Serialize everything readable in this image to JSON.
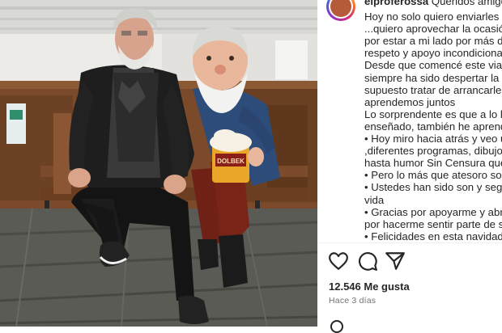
{
  "post": {
    "username": "elproferossa",
    "caption_first": "Queridos amigos",
    "caption_lines": [
      "Hoy no solo quiero enviarles un",
      "...quiero aprovechar la ocasión p",
      "por estar a mi lado por más de c",
      "respeto y apoyo incondicional",
      "Desde que comencé este viaje c",
      "siempre ha sido despertar la cur",
      "supuesto tratar de arrancarles u",
      "aprendemos juntos",
      "Lo sorprendente es que a lo larg",
      "enseñado, también he aprendid",
      "• Hoy miro hacia atrás y veo un",
      ",diferentes programas, dibujos ,c",
      "hasta humor Sin Censura que co",
      "• Pero lo más que atesoro son lo",
      "• Ustedes han sido son y seguirá",
      "vida",
      "• Gracias por apoyarme y abrirm",
      "por hacerme sentir parte de sus",
      "• Felicidades en esta navidad y c"
    ],
    "likes": "12.546 Me gusta",
    "time_ago": "Hace 3 días",
    "mug_label": "DOLBEK"
  },
  "icons": {
    "like": "heart-icon",
    "comment": "comment-icon",
    "share": "share-icon"
  }
}
